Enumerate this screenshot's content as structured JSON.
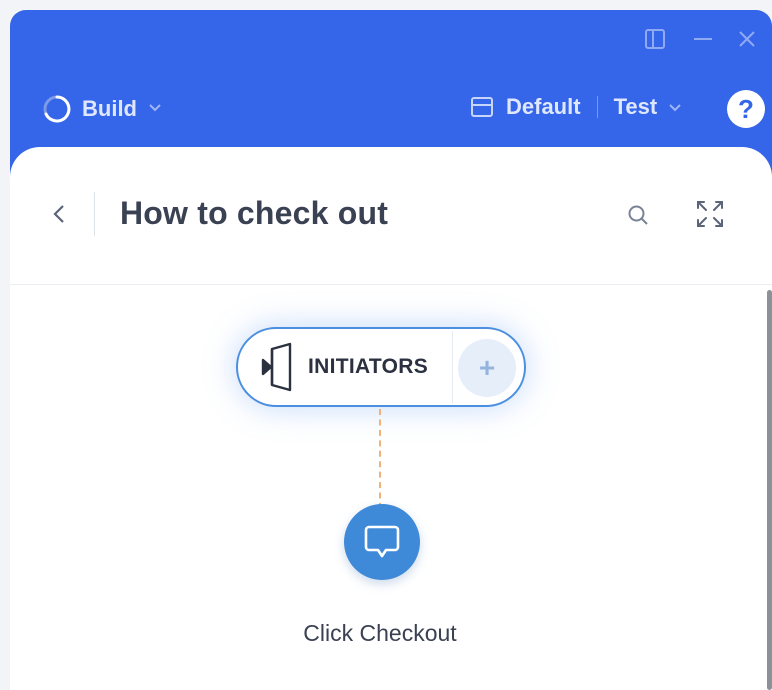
{
  "window": {
    "controls": [
      "layout-icon",
      "minimize-icon",
      "close-icon"
    ]
  },
  "toolbar": {
    "mode_label": "Build",
    "layout_label": "Default",
    "env_label": "Test",
    "help_label": "?"
  },
  "panel": {
    "title": "How to check out"
  },
  "flow": {
    "initiators_label": "INITIATORS",
    "add_label": "+",
    "steps": [
      {
        "label": "Click Checkout",
        "icon": "speech-bubble-icon"
      }
    ]
  },
  "colors": {
    "brand": "#3565e8",
    "node": "#3f8ad8",
    "connector": "#f0b27a",
    "initiators_border": "#4a8fe0"
  }
}
